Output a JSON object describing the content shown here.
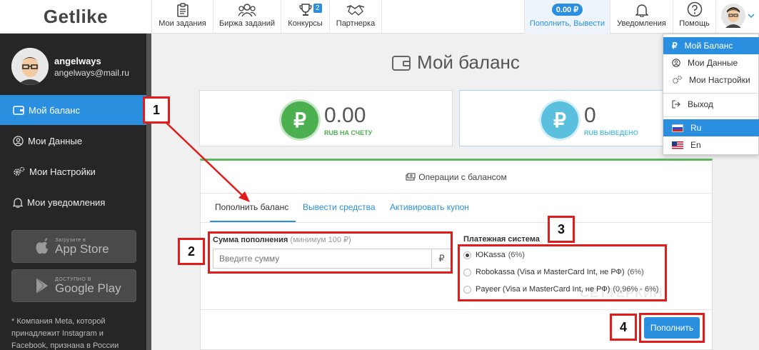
{
  "app": {
    "logo": "Getlike"
  },
  "topnav": {
    "items": [
      {
        "label": "Мои задания",
        "icon": "clipboard-icon"
      },
      {
        "label": "Биржа заданий",
        "icon": "people-icon"
      },
      {
        "label": "Конкурсы",
        "icon": "trophy-icon",
        "badge": "2"
      },
      {
        "label": "Партнерка",
        "icon": "handshake-icon"
      }
    ],
    "balance": {
      "amount": "0.00 ₽",
      "label": "Пополнить, Вывести"
    },
    "notifications_label": "Уведомления",
    "help_label": "Помощь"
  },
  "user": {
    "name": "angelways",
    "email": "angelways@mail.ru"
  },
  "sidebar": {
    "items": [
      {
        "label": "Мой баланс",
        "icon": "wallet-icon",
        "active": true
      },
      {
        "label": "Мои Данные",
        "icon": "user-circle-icon"
      },
      {
        "label": "Мои Настройки",
        "icon": "gears-icon"
      },
      {
        "label": "Мои уведомления",
        "icon": "bell-icon"
      }
    ],
    "app_store": {
      "small": "Загрузите в",
      "big": "App Store"
    },
    "google_play": {
      "small": "ДОСТУПНО В",
      "big": "Google Play"
    },
    "note": "* Компания Meta, которой принадлежит Instagram и Facebook, признана в России"
  },
  "page": {
    "title": "Мой баланс",
    "stats": [
      {
        "value": "0.00",
        "label": "RUB НА СЧЕТУ",
        "color": "#4caf50"
      },
      {
        "value": "0",
        "label": "RUB ВЫВЕДЕНО",
        "color": "#5bc0de"
      }
    ],
    "ops": {
      "header": "Операции с балансом",
      "tabs": [
        "Пополнить баланс",
        "Вывести средства",
        "Активировать купон"
      ],
      "amount_label": "Сумма пополнения",
      "amount_hint": "(минимум 100 ₽)",
      "amount_placeholder": "Введите сумму",
      "currency": "₽",
      "payment_label": "Платежная система",
      "payment_options": [
        {
          "name": "ЮKassa",
          "extra": "(6%)",
          "checked": true
        },
        {
          "name": "Robokassa (Visa и MasterCard Int, не РФ)",
          "extra": "(6%)",
          "checked": false
        },
        {
          "name": "Payeer (Visa и MasterCard Int, не РФ)",
          "extra": "(0,96% - 6%)",
          "checked": false
        }
      ],
      "submit_label": "Пополнить"
    }
  },
  "dropdown": {
    "items": [
      "Мой Баланс",
      "Мои Данные",
      "Мои Настройки",
      "Выход",
      "Ru",
      "En"
    ]
  },
  "annotations": [
    "1",
    "2",
    "3",
    "4"
  ],
  "watermark": "СЕТТЕРКИН",
  "colors": {
    "accent": "#2b8fe0",
    "sidebar": "#262626",
    "highlight": "#e41b1b",
    "success": "#5cb85c"
  }
}
